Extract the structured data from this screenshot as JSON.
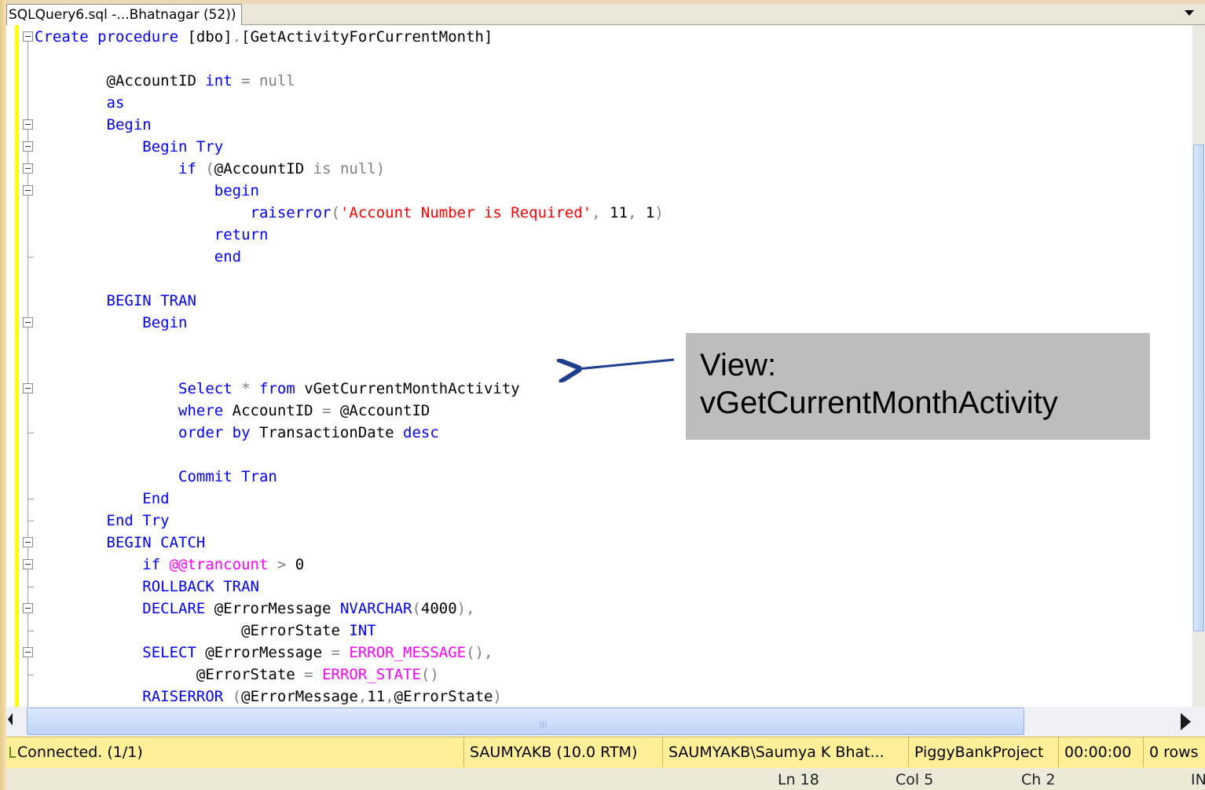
{
  "tab": {
    "title": "SQLQuery6.sql -...Bhatnagar (52))"
  },
  "code_lines": [
    [
      {
        "t": "Create procedure ",
        "c": "kw"
      },
      {
        "t": "[dbo]",
        "c": ""
      },
      {
        "t": ".",
        "c": "gr"
      },
      {
        "t": "[GetActivityForCurrentMonth]",
        "c": ""
      }
    ],
    [],
    [
      {
        "t": "        @AccountID ",
        "c": ""
      },
      {
        "t": "int",
        "c": "kw"
      },
      {
        "t": " = null",
        "c": "gr"
      }
    ],
    [
      {
        "t": "        as",
        "c": "kw"
      }
    ],
    [
      {
        "t": "        Begin",
        "c": "kw"
      }
    ],
    [
      {
        "t": "            Begin Try",
        "c": "kw"
      }
    ],
    [
      {
        "t": "                if",
        "c": "kw"
      },
      {
        "t": " (",
        "c": "gr"
      },
      {
        "t": "@AccountID ",
        "c": ""
      },
      {
        "t": "is null)",
        "c": "gr"
      }
    ],
    [
      {
        "t": "                    begin",
        "c": "kw"
      }
    ],
    [
      {
        "t": "                        raiserror",
        "c": "kw"
      },
      {
        "t": "(",
        "c": "gr"
      },
      {
        "t": "'Account Number is Required'",
        "c": "st"
      },
      {
        "t": ", ",
        "c": "gr"
      },
      {
        "t": "11",
        "c": ""
      },
      {
        "t": ", ",
        "c": "gr"
      },
      {
        "t": "1",
        "c": ""
      },
      {
        "t": ")",
        "c": "gr"
      }
    ],
    [
      {
        "t": "                    return",
        "c": "kw"
      }
    ],
    [
      {
        "t": "                    end",
        "c": "kw"
      }
    ],
    [],
    [
      {
        "t": "        BEGIN TRAN",
        "c": "kw"
      }
    ],
    [
      {
        "t": "            Begin",
        "c": "kw"
      }
    ],
    [],
    [],
    [
      {
        "t": "                Select ",
        "c": "kw"
      },
      {
        "t": "* ",
        "c": "gr"
      },
      {
        "t": "from ",
        "c": "kw"
      },
      {
        "t": "vGetCurrentMonthActivity",
        "c": ""
      }
    ],
    [
      {
        "t": "                where ",
        "c": "kw"
      },
      {
        "t": "AccountID ",
        "c": ""
      },
      {
        "t": "= ",
        "c": "gr"
      },
      {
        "t": "@AccountID",
        "c": ""
      }
    ],
    [
      {
        "t": "                order by ",
        "c": "kw"
      },
      {
        "t": "TransactionDate ",
        "c": ""
      },
      {
        "t": "desc",
        "c": "kw"
      }
    ],
    [],
    [
      {
        "t": "                Commit Tran",
        "c": "kw"
      }
    ],
    [
      {
        "t": "            End",
        "c": "kw"
      }
    ],
    [
      {
        "t": "        End Try",
        "c": "kw"
      }
    ],
    [
      {
        "t": "        BEGIN CATCH",
        "c": "kw"
      }
    ],
    [
      {
        "t": "            if ",
        "c": "kw"
      },
      {
        "t": "@@trancount ",
        "c": "mg"
      },
      {
        "t": "> ",
        "c": "gr"
      },
      {
        "t": "0",
        "c": ""
      }
    ],
    [
      {
        "t": "            ROLLBACK TRAN",
        "c": "kw"
      }
    ],
    [
      {
        "t": "            DECLARE ",
        "c": "kw"
      },
      {
        "t": "@ErrorMessage ",
        "c": ""
      },
      {
        "t": "NVARCHAR",
        "c": "kw"
      },
      {
        "t": "(",
        "c": "gr"
      },
      {
        "t": "4000",
        "c": ""
      },
      {
        "t": "),",
        "c": "gr"
      }
    ],
    [
      {
        "t": "                       @ErrorState ",
        "c": ""
      },
      {
        "t": "INT",
        "c": "kw"
      }
    ],
    [
      {
        "t": "            SELECT ",
        "c": "kw"
      },
      {
        "t": "@ErrorMessage ",
        "c": ""
      },
      {
        "t": "= ",
        "c": "gr"
      },
      {
        "t": "ERROR_MESSAGE",
        "c": "mg"
      },
      {
        "t": "(),",
        "c": "gr"
      }
    ],
    [
      {
        "t": "                  @ErrorState ",
        "c": ""
      },
      {
        "t": "= ",
        "c": "gr"
      },
      {
        "t": "ERROR_STATE",
        "c": "mg"
      },
      {
        "t": "()",
        "c": "gr"
      }
    ],
    [
      {
        "t": "            RAISERROR ",
        "c": "kw"
      },
      {
        "t": "(",
        "c": "gr"
      },
      {
        "t": "@ErrorMessage",
        "c": ""
      },
      {
        "t": ",",
        "c": "gr"
      },
      {
        "t": "11",
        "c": ""
      },
      {
        "t": ",",
        "c": "gr"
      },
      {
        "t": "@ErrorState",
        "c": ""
      },
      {
        "t": ")",
        "c": "gr"
      }
    ]
  ],
  "fold_open_lines": [
    0,
    4,
    5,
    6,
    7,
    13,
    16,
    23,
    24,
    26,
    28
  ],
  "fold_end_lines": [
    10,
    18,
    21,
    22,
    25,
    27,
    29
  ],
  "colors": {
    "keyword": "#0000ff",
    "comment_gray": "#808080",
    "string": "#ff0000",
    "function": "#ff00ff",
    "status_bar": "#ffef99",
    "callout_bg": "#bdbdbd",
    "arrow": "#1f3f8f"
  },
  "callout": {
    "line1": "View:",
    "line2": "vGetCurrentMonthActivity"
  },
  "status": {
    "connection": "Connected. (1/1)",
    "server": "SAUMYAKB (10.0 RTM)",
    "user": "SAUMYAKB\\Saumya K Bhat...",
    "database": "PiggyBankProject",
    "elapsed": "00:00:00",
    "rows": "0 rows"
  },
  "position": {
    "ln": "Ln 18",
    "col": "Col 5",
    "ch": "Ch 2",
    "mode": "IN"
  },
  "icons": {
    "tab_dropdown": "chevron-down-icon",
    "connection": "connection-icon",
    "scroll_right": "arrow-right-icon",
    "scroll_left": "arrow-left-icon"
  }
}
